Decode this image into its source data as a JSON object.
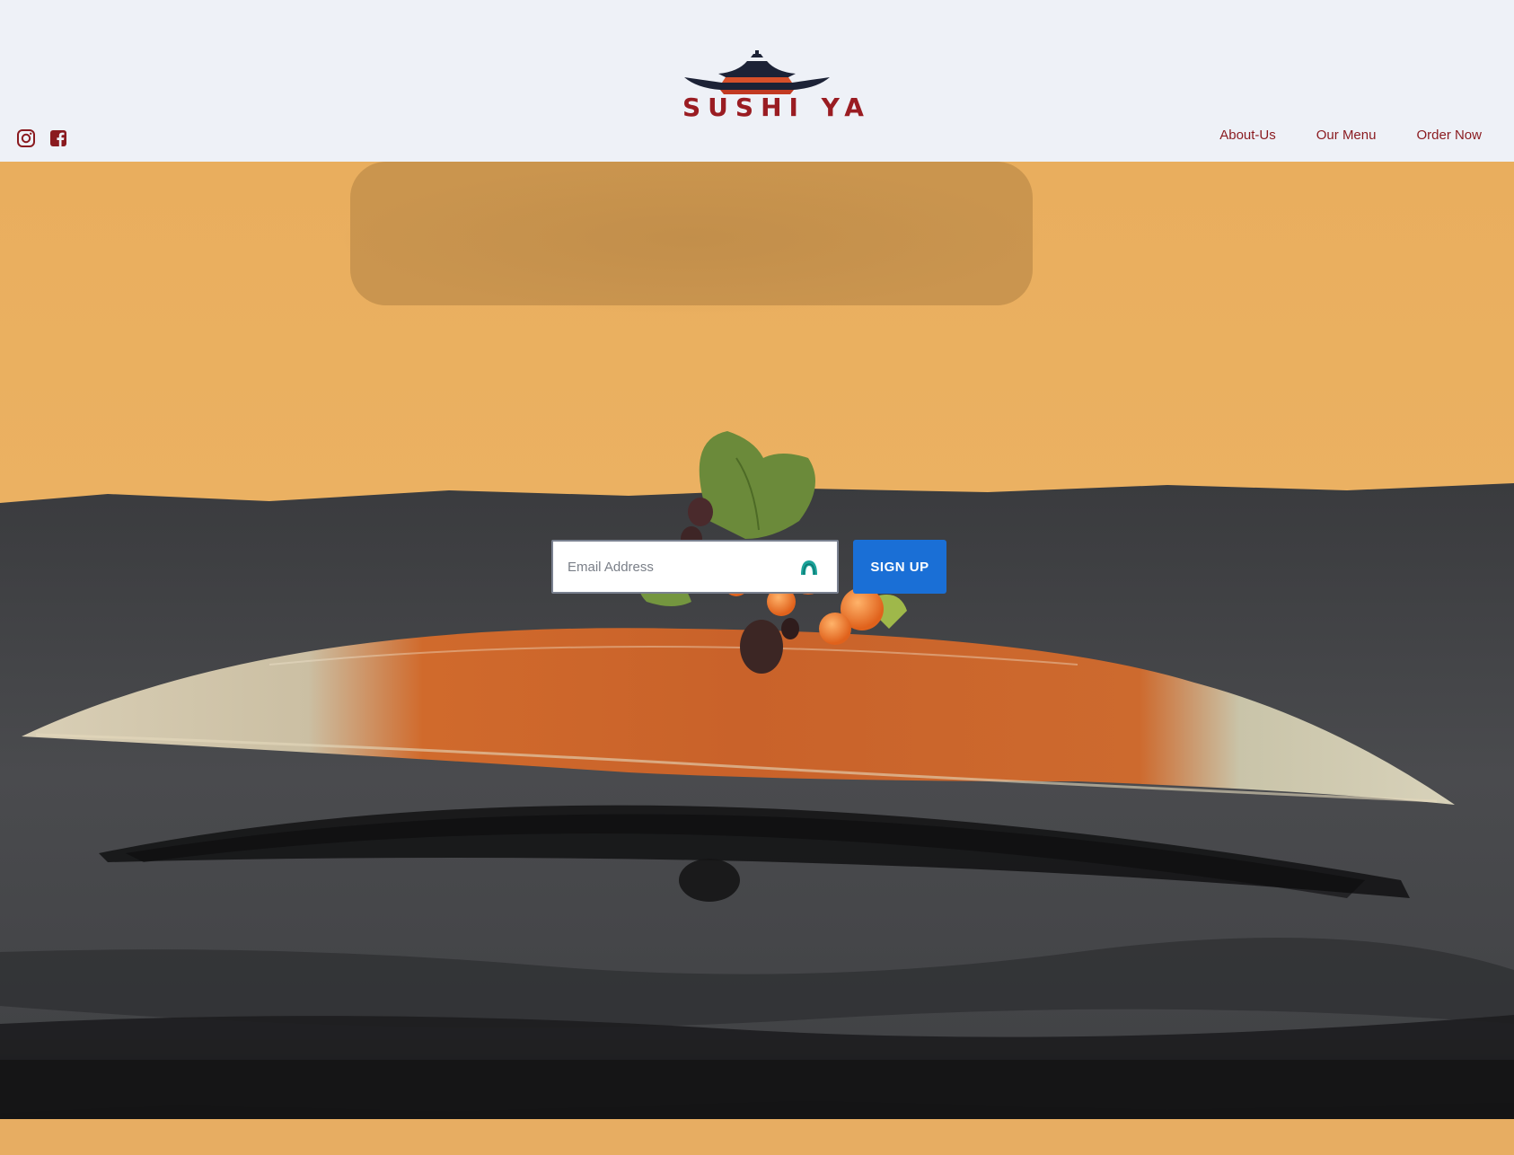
{
  "brand": {
    "name": "SUSHI YA",
    "primary_color": "#9a1c22",
    "roof_color": "#1c2236",
    "accent_color": "#d8502a"
  },
  "social": [
    {
      "icon": "instagram-icon"
    },
    {
      "icon": "facebook-icon"
    }
  ],
  "nav": {
    "items": [
      {
        "label": "About-Us"
      },
      {
        "label": "Our Menu"
      },
      {
        "label": "Order Now"
      }
    ]
  },
  "hero": {
    "image": "sushi-on-slate-plate"
  },
  "signup": {
    "email_placeholder": "Email Address",
    "email_value": "",
    "field_icon": "password-manager-icon",
    "button_label": "SIGN UP",
    "button_color": "#1a6fd6"
  }
}
